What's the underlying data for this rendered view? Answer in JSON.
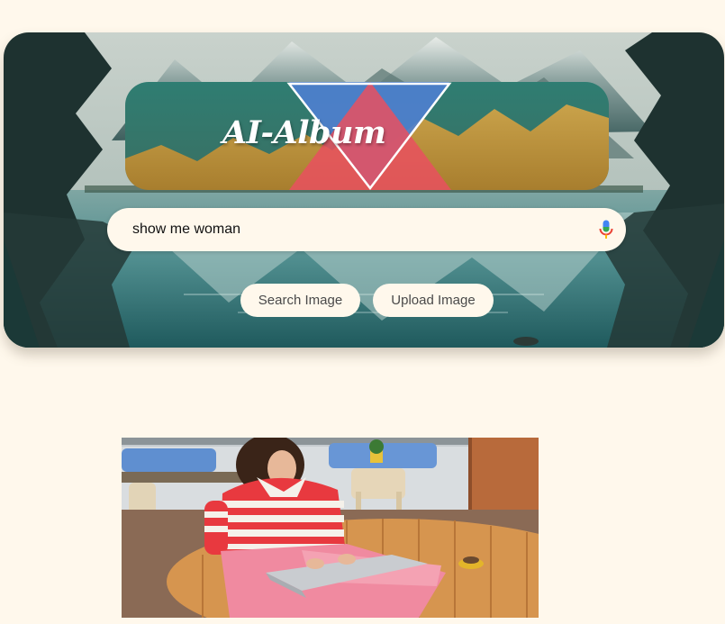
{
  "banner": {
    "title": "AI-Album"
  },
  "search": {
    "value": "show me woman",
    "mic_icon": "microphone-icon"
  },
  "buttons": {
    "search_label": "Search Image",
    "upload_label": "Upload Image"
  },
  "results": [
    {
      "description_icon": "result-photo"
    }
  ],
  "colors": {
    "page_background": "#fff8ec",
    "button_background": "#fff8ec",
    "button_text": "#4a4a4a"
  }
}
